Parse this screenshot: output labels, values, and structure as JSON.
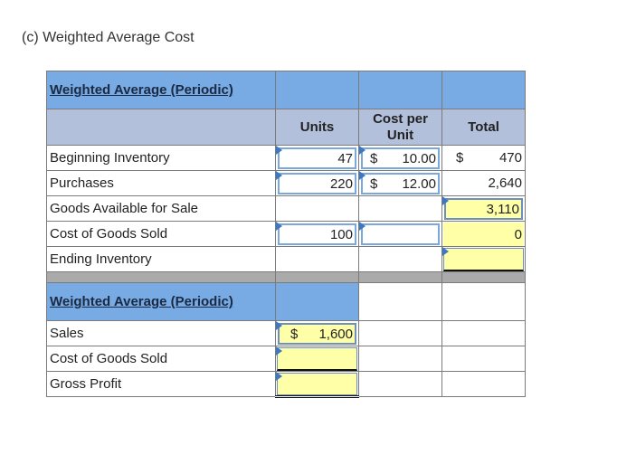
{
  "page": {
    "title": "(c) Weighted Average Cost"
  },
  "table1": {
    "section_title": "Weighted Average (Periodic)",
    "columns": [
      "Units",
      "Cost per Unit",
      "Total"
    ],
    "rows": [
      {
        "label": "Beginning Inventory",
        "units": "47",
        "cost_currency": "$",
        "cost": "10.00",
        "total_currency": "$",
        "total": "470"
      },
      {
        "label": "Purchases",
        "units": "220",
        "cost_currency": "$",
        "cost": "12.00",
        "total_currency": "",
        "total": "2,640"
      },
      {
        "label": "Goods Available for Sale",
        "units": "",
        "cost": "",
        "total": "3,110"
      },
      {
        "label": "Cost of Goods Sold",
        "units": "100",
        "cost": "",
        "total": "0"
      },
      {
        "label": "Ending Inventory",
        "units": "",
        "cost": "",
        "total": ""
      }
    ]
  },
  "table2": {
    "section_title": "Weighted Average (Periodic)",
    "rows": [
      {
        "label": "Sales",
        "currency": "$",
        "value": "1,600"
      },
      {
        "label": "Cost of Goods Sold",
        "currency": "",
        "value": ""
      },
      {
        "label": "Gross Profit",
        "currency": "",
        "value": ""
      }
    ]
  },
  "colors": {
    "header_blue": "#78aae3",
    "subheader_lavender": "#b3c0dc",
    "separator_gray": "#aaaaaa",
    "input_border": "#7aa7dc",
    "computed_yellow": "#ffffa8",
    "input_flag": "#3e78c2"
  }
}
